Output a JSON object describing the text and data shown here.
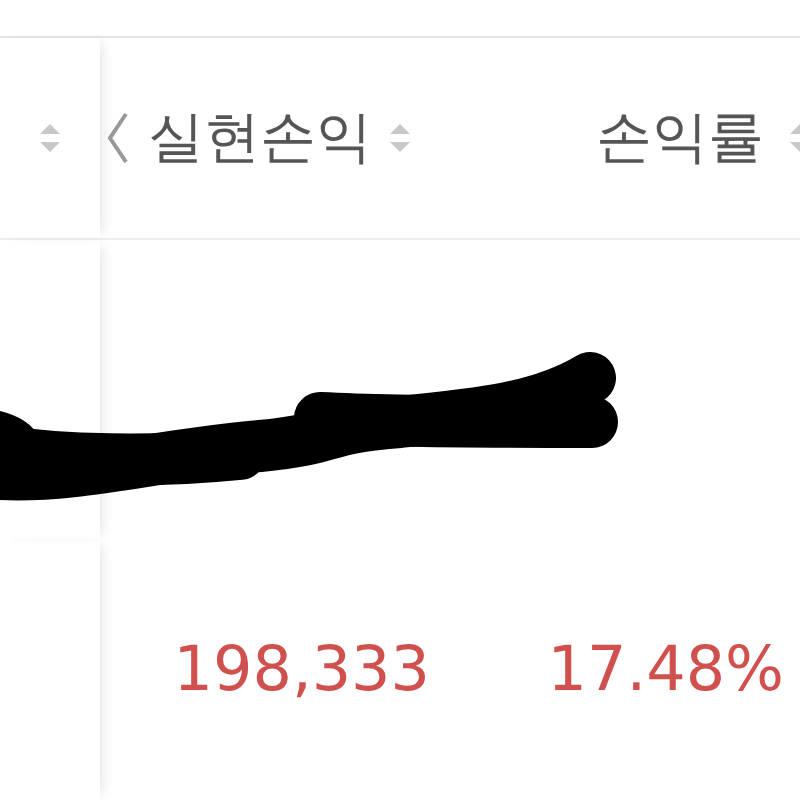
{
  "columns": [
    {
      "sortable": true
    },
    {
      "label": "실현손익",
      "sortable": true
    },
    {
      "label": "손익률",
      "sortable": true
    }
  ],
  "rows": [
    {
      "kind": "redacted"
    },
    {
      "kind": "values",
      "cells": [
        "",
        "198,333",
        "17.48%"
      ]
    }
  ]
}
